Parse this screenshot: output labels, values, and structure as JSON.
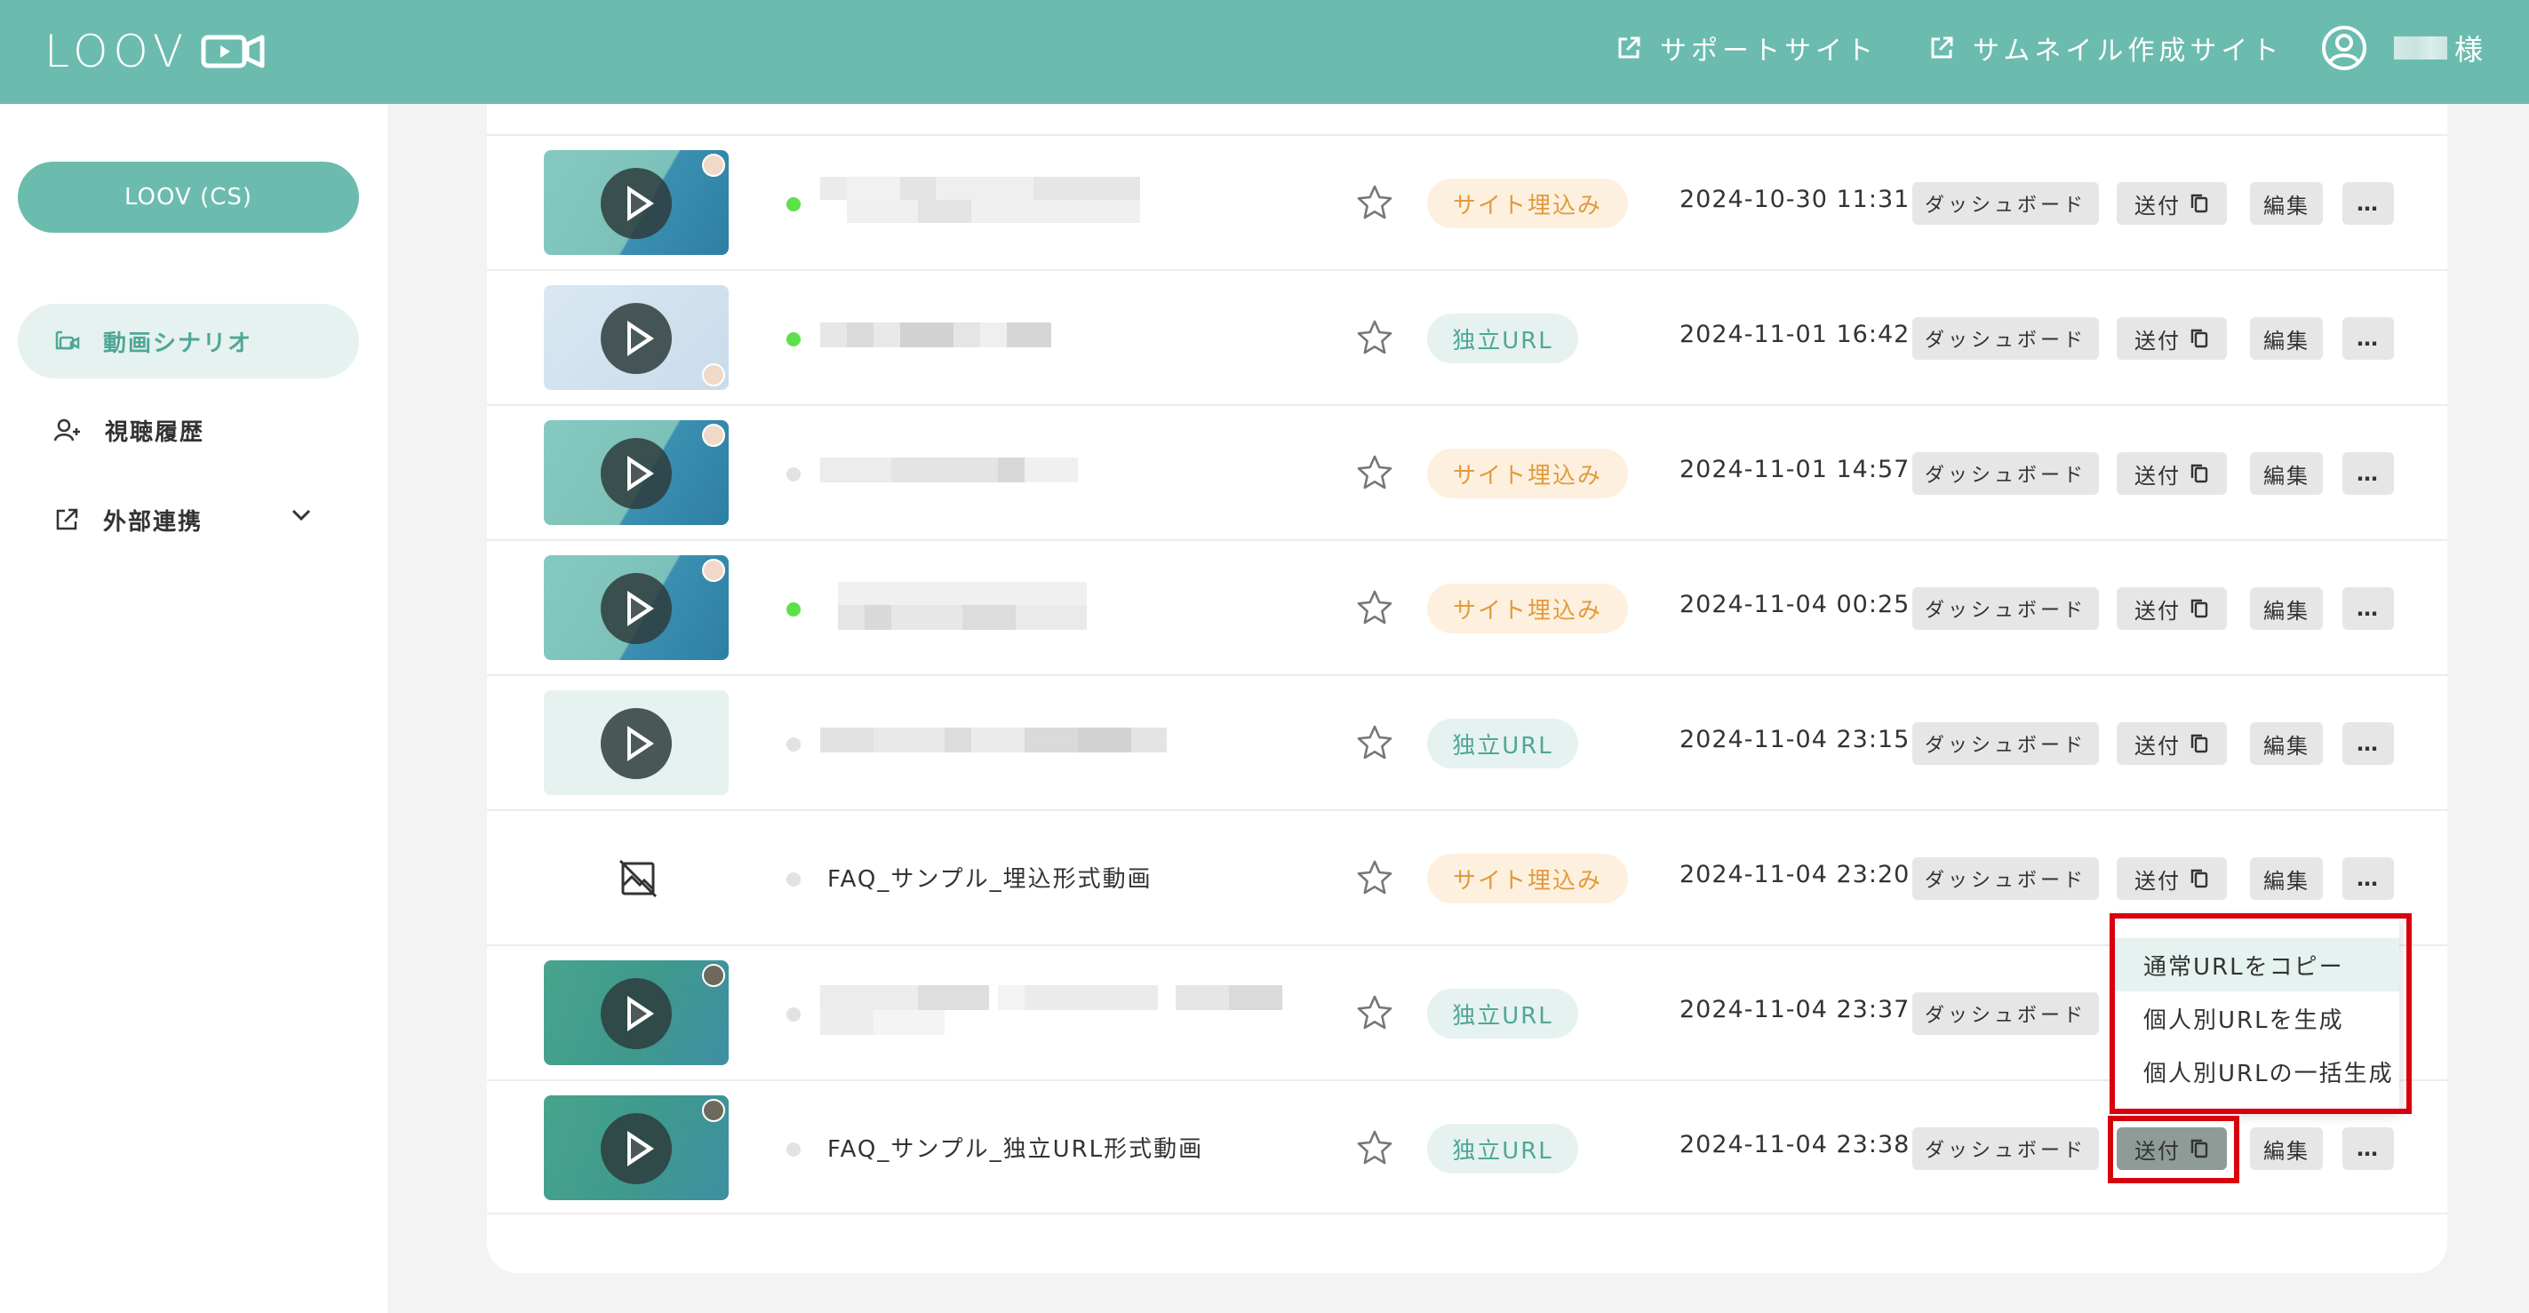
{
  "header": {
    "logo": "LOOV",
    "support_link": "サポートサイト",
    "thumbnail_link": "サムネイル作成サイト",
    "user_suffix": "様",
    "bg_color": "#6bbcae"
  },
  "sidebar": {
    "org_button": "LOOV (CS)",
    "items": [
      {
        "label": "動画シナリオ",
        "icon": "video-scenario-icon",
        "active": true
      },
      {
        "label": "視聴履歴",
        "icon": "person-add-icon",
        "active": false
      },
      {
        "label": "外部連携",
        "icon": "external-link-icon",
        "active": false
      }
    ]
  },
  "row_buttons": {
    "dashboard": "ダッシュボード",
    "send": "送付",
    "edit": "編集",
    "more": "…"
  },
  "rows": [
    {
      "title": "",
      "tag": "サイト埋込み",
      "date": "2024-10-30 11:31",
      "published": true,
      "thumbnail": "embed-slide"
    },
    {
      "title": "",
      "tag": "独立URL",
      "date": "2024-11-01 16:42",
      "published": true,
      "thumbnail": "presenter"
    },
    {
      "title": "",
      "tag": "サイト埋込み",
      "date": "2024-11-01 14:57",
      "published": false,
      "thumbnail": "embed-slide"
    },
    {
      "title": "",
      "tag": "サイト埋込み",
      "date": "2024-11-04 00:25",
      "published": true,
      "thumbnail": "embed-slide"
    },
    {
      "title": "",
      "tag": "独立URL",
      "date": "2024-11-04 23:15",
      "published": false,
      "thumbnail": "placeholder"
    },
    {
      "title": "FAQ_サンプル_埋込形式動画",
      "tag": "サイト埋込み",
      "date": "2024-11-04 23:20",
      "published": false,
      "thumbnail": "none"
    },
    {
      "title": "",
      "tag": "独立URL",
      "date": "2024-11-04 23:37",
      "published": false,
      "thumbnail": "green-slide"
    },
    {
      "title": "FAQ_サンプル_独立URL形式動画",
      "tag": "独立URL",
      "date": "2024-11-04 23:38",
      "published": false,
      "thumbnail": "green-slide"
    }
  ],
  "send_menu": {
    "items": [
      "通常URLをコピー",
      "個人別URLを生成",
      "個人別URLの一括生成"
    ],
    "highlight_color": "#d9000d"
  }
}
